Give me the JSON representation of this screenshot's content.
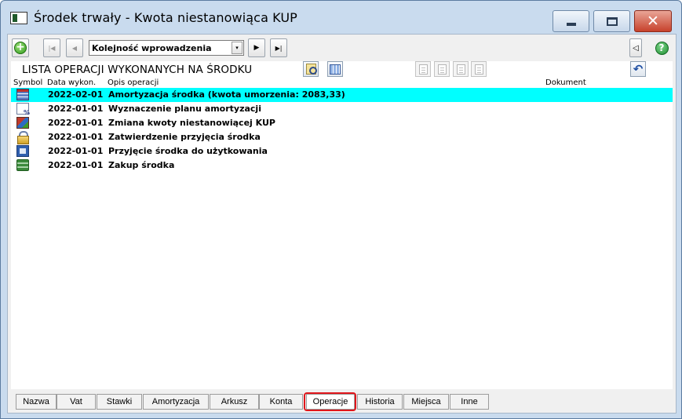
{
  "window": {
    "title": "Środek trwały - Kwota niestanowiąca KUP",
    "minimize_glyph": "—",
    "maximize_glyph": "□",
    "close_glyph": "✕"
  },
  "toolbar": {
    "add_icon": "+",
    "first_glyph": "|◀",
    "prev_glyph": "◀",
    "order_value": "Kolejność wprowadzenia",
    "order_arrow": "▾",
    "next_glyph": "▶",
    "last_glyph": "▶|",
    "collapse_glyph": "◁",
    "help_icon": "?"
  },
  "section": {
    "title": "LISTA OPERACJI WYKONANYCH NA ŚRODKU"
  },
  "table": {
    "headers": {
      "symbol": "Symbol",
      "date": "Data wykon.",
      "description": "Opis operacji",
      "document": "Dokument"
    },
    "rows": [
      {
        "icon": "calendar-depreciation-icon",
        "date": "2022-02-01",
        "description": "Amortyzacja środka (kwota umorzenia: 2083,33)",
        "document": "",
        "selected": true
      },
      {
        "icon": "depreciation-plan-icon",
        "date": "2022-01-01",
        "description": "Wyznaczenie planu amortyzacji",
        "document": "",
        "selected": false
      },
      {
        "icon": "amount-change-icon",
        "date": "2022-01-01",
        "description": "Zmiana kwoty niestanowiącej KUP",
        "document": "",
        "selected": false
      },
      {
        "icon": "lock-icon",
        "date": "2022-01-01",
        "description": "Zatwierdzenie przyjęcia środka",
        "document": "",
        "selected": false
      },
      {
        "icon": "acceptance-icon",
        "date": "2022-01-01",
        "description": "Przyjęcie środka do użytkowania",
        "document": "",
        "selected": false
      },
      {
        "icon": "purchase-money-icon",
        "date": "2022-01-01",
        "description": "Zakup środka",
        "document": "",
        "selected": false
      }
    ]
  },
  "tabs": [
    {
      "label": "Nazwa",
      "active": false
    },
    {
      "label": "Vat",
      "active": false
    },
    {
      "label": "Stawki",
      "active": false
    },
    {
      "label": "Amortyzacja",
      "active": false
    },
    {
      "label": "Arkusz",
      "active": false
    },
    {
      "label": "Konta",
      "active": false
    },
    {
      "label": "Operacje",
      "active": true
    },
    {
      "label": "Historia",
      "active": false
    },
    {
      "label": "Miejsca",
      "active": false
    },
    {
      "label": "Inne",
      "active": false
    }
  ],
  "colors": {
    "selected_row": "#00ffff",
    "active_tab_outline": "#e0161b",
    "window_frame": "#c9dbee"
  }
}
